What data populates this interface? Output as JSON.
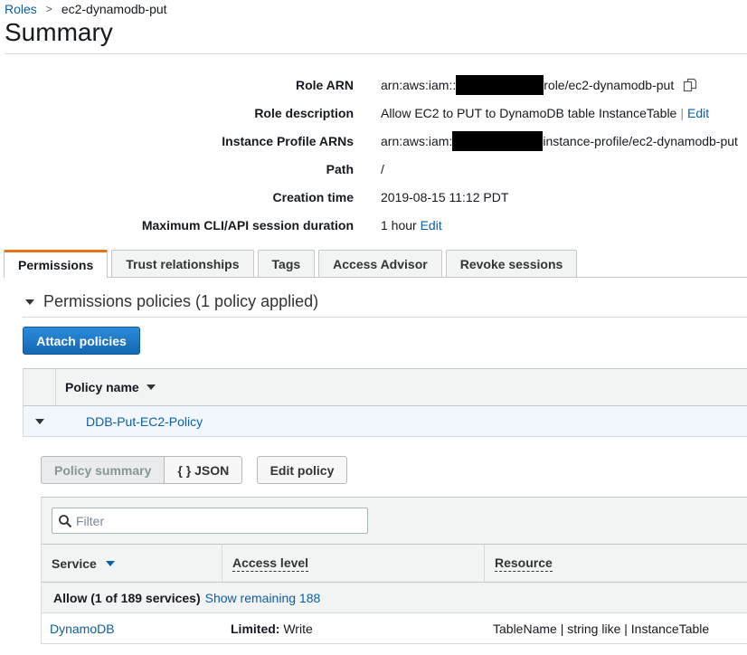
{
  "breadcrumb": {
    "parent": "Roles",
    "current": "ec2-dynamodb-put"
  },
  "page_title": "Summary",
  "summary": {
    "role_arn": {
      "label": "Role ARN",
      "prefix": "arn:aws:iam::",
      "suffix": "role/ec2-dynamodb-put"
    },
    "role_description": {
      "label": "Role description",
      "value": "Allow EC2 to PUT to DynamoDB table InstanceTable",
      "edit": "Edit"
    },
    "instance_profile": {
      "label": "Instance Profile ARNs",
      "prefix": "arn:aws:iam:",
      "suffix": "instance-profile/ec2-dynamodb-put"
    },
    "path": {
      "label": "Path",
      "value": "/"
    },
    "creation_time": {
      "label": "Creation time",
      "value": "2019-08-15 11:12 PDT"
    },
    "max_session": {
      "label": "Maximum CLI/API session duration",
      "value": "1 hour",
      "edit": "Edit"
    }
  },
  "tabs": [
    "Permissions",
    "Trust relationships",
    "Tags",
    "Access Advisor",
    "Revoke sessions"
  ],
  "permissions": {
    "section_title": "Permissions policies (1 policy applied)",
    "attach_button": "Attach policies",
    "column_policy_name": "Policy name",
    "policy_name": "DDB-Put-EC2-Policy"
  },
  "policy_detail": {
    "policy_summary_button": "Policy summary",
    "json_button": "{ } JSON",
    "edit_policy_button": "Edit policy",
    "filter_placeholder": "Filter",
    "columns": {
      "service": "Service",
      "access_level": "Access level",
      "resource": "Resource"
    },
    "allow_label": "Allow (1 of 189 services)",
    "show_remaining": "Show remaining 188",
    "row": {
      "service": "DynamoDB",
      "access_level_bold": "Limited:",
      "access_level_value": "Write",
      "resource": "TableName | string like | InstanceTable"
    }
  },
  "colors": {
    "link": "#0b5fa8",
    "active_tab_accent": "#ec7211",
    "primary_button": "#1a73c8"
  }
}
